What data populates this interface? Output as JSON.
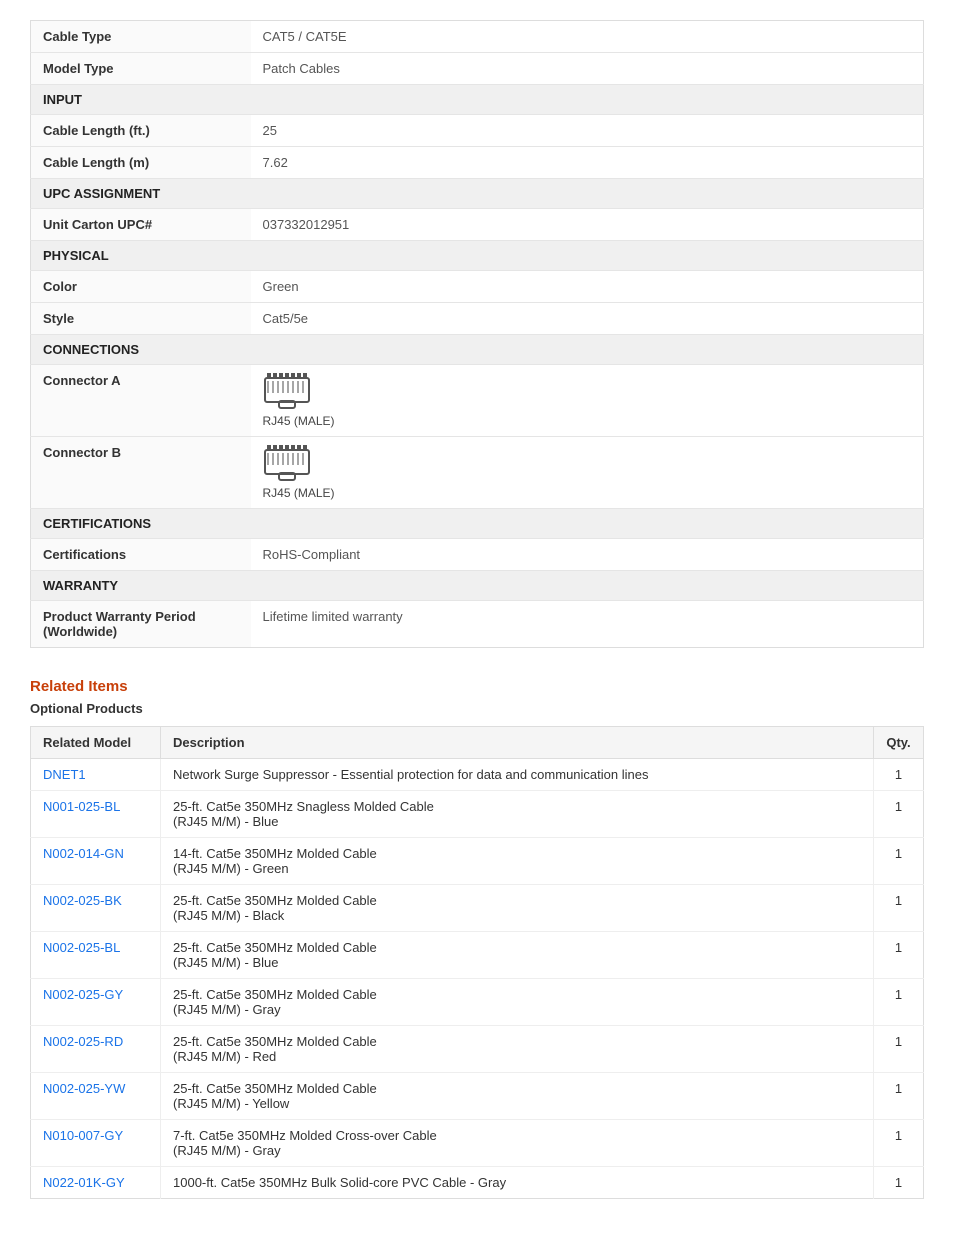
{
  "specs": {
    "rows": [
      {
        "type": "data",
        "label": "Cable Type",
        "value": "CAT5 / CAT5E"
      },
      {
        "type": "data",
        "label": "Model Type",
        "value": "Patch Cables"
      },
      {
        "type": "section",
        "label": "INPUT"
      },
      {
        "type": "data",
        "label": "Cable Length (ft.)",
        "value": "25"
      },
      {
        "type": "data",
        "label": "Cable Length (m)",
        "value": "7.62"
      },
      {
        "type": "section",
        "label": "UPC ASSIGNMENT"
      },
      {
        "type": "data",
        "label": "Unit Carton UPC#",
        "value": "037332012951"
      },
      {
        "type": "section",
        "label": "PHYSICAL"
      },
      {
        "type": "data",
        "label": "Color",
        "value": "Green"
      },
      {
        "type": "data",
        "label": "Style",
        "value": "Cat5/5e"
      },
      {
        "type": "section",
        "label": "CONNECTIONS"
      },
      {
        "type": "connector",
        "label": "Connector A",
        "value": "RJ45 (MALE)"
      },
      {
        "type": "connector",
        "label": "Connector B",
        "value": "RJ45 (MALE)"
      },
      {
        "type": "section",
        "label": "CERTIFICATIONS"
      },
      {
        "type": "data",
        "label": "Certifications",
        "value": "RoHS-Compliant"
      },
      {
        "type": "section",
        "label": "WARRANTY"
      },
      {
        "type": "data",
        "label": "Product Warranty Period (Worldwide)",
        "value": "Lifetime limited warranty"
      }
    ]
  },
  "related": {
    "title": "Related Items",
    "subtitle": "Optional Products",
    "columns": [
      "Related Model",
      "Description",
      "Qty."
    ],
    "items": [
      {
        "model": "DNET1",
        "description": "Network Surge Suppressor - Essential protection for data and communication lines",
        "qty": "1"
      },
      {
        "model": "N001-025-BL",
        "description": "25-ft. Cat5e 350MHz Snagless Molded Cable\n(RJ45 M/M) - Blue",
        "qty": "1"
      },
      {
        "model": "N002-014-GN",
        "description": "14-ft. Cat5e 350MHz Molded Cable\n(RJ45 M/M) - Green",
        "qty": "1"
      },
      {
        "model": "N002-025-BK",
        "description": "25-ft. Cat5e 350MHz Molded Cable\n(RJ45 M/M) - Black",
        "qty": "1"
      },
      {
        "model": "N002-025-BL",
        "description": "25-ft. Cat5e 350MHz Molded Cable\n(RJ45 M/M) - Blue",
        "qty": "1"
      },
      {
        "model": "N002-025-GY",
        "description": "25-ft. Cat5e 350MHz Molded Cable\n(RJ45 M/M) - Gray",
        "qty": "1"
      },
      {
        "model": "N002-025-RD",
        "description": "25-ft. Cat5e 350MHz Molded Cable\n(RJ45 M/M) - Red",
        "qty": "1"
      },
      {
        "model": "N002-025-YW",
        "description": "25-ft. Cat5e 350MHz Molded Cable\n(RJ45 M/M) - Yellow",
        "qty": "1"
      },
      {
        "model": "N010-007-GY",
        "description": "7-ft. Cat5e 350MHz Molded Cross-over Cable\n(RJ45 M/M) - Gray",
        "qty": "1"
      },
      {
        "model": "N022-01K-GY",
        "description": "1000-ft. Cat5e 350MHz Bulk Solid-core PVC Cable - Gray",
        "qty": "1"
      }
    ]
  }
}
